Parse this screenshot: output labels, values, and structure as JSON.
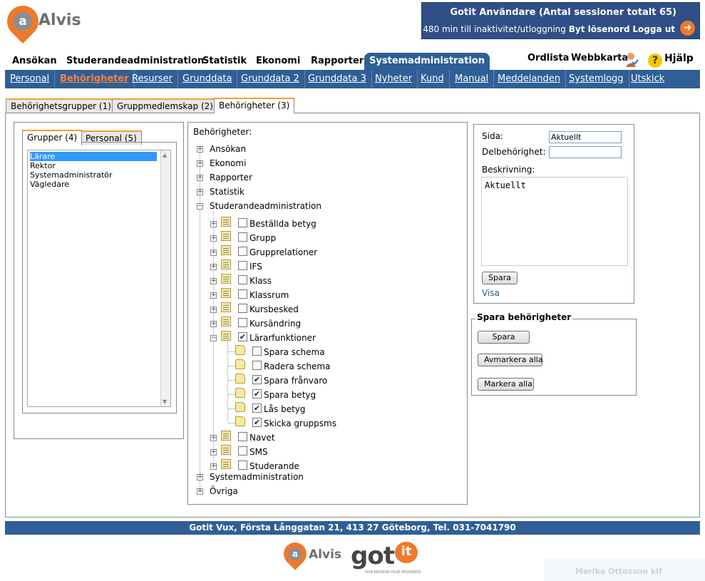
{
  "header": {
    "brand": "Alvis",
    "brand_letter": "a",
    "user_line": "Gotit Användare (Antal sessioner totalt 65)",
    "session_text": "480 min till inaktivitet/utloggning",
    "change_password": "Byt lösenord",
    "logout": "Logga ut",
    "logout_icon": "arrow-right-circle-icon"
  },
  "main_menu": [
    {
      "label": "Ansökan",
      "active": false
    },
    {
      "label": "Studerandeadministration",
      "active": false
    },
    {
      "label": "Statistik",
      "active": false
    },
    {
      "label": "Ekonomi",
      "active": false
    },
    {
      "label": "Rapporter",
      "active": false
    },
    {
      "label": "Systemadministration",
      "active": true
    }
  ],
  "top_links": {
    "glossary": "Ordlista",
    "sitemap": "Webbkarta",
    "help": "Hjälp",
    "help_icon": "?"
  },
  "sub_menu": [
    {
      "label": "Personal",
      "active": false
    },
    {
      "label": "Behörigheter",
      "active": true
    },
    {
      "label": "Resurser",
      "active": false
    },
    {
      "label": "Grunddata",
      "active": false
    },
    {
      "label": "Grunddata 2",
      "active": false
    },
    {
      "label": "Grunddata 3",
      "active": false
    },
    {
      "label": "Nyheter",
      "active": false
    },
    {
      "label": "Kund",
      "active": false
    },
    {
      "label": "Manual",
      "active": false
    },
    {
      "label": "Meddelanden",
      "active": false
    },
    {
      "label": "Systemlogg",
      "active": false
    },
    {
      "label": "Utskick",
      "active": false
    }
  ],
  "outer_tabs": [
    {
      "label": "Behörighetsgrupper (1)",
      "active": false
    },
    {
      "label": "Gruppmedlemskap (2)",
      "active": false
    },
    {
      "label": "Behörigheter (3)",
      "active": true
    }
  ],
  "group_tabs": [
    {
      "label": "Grupper (4)",
      "active": true
    },
    {
      "label": "Personal (5)",
      "active": false
    }
  ],
  "groups": [
    {
      "label": "Lärare",
      "selected": true
    },
    {
      "label": "Rektor",
      "selected": false
    },
    {
      "label": "Systemadministratör",
      "selected": false
    },
    {
      "label": "Vägledare",
      "selected": false
    }
  ],
  "tree": {
    "heading": "Behörigheter:",
    "top_before": [
      "Ansökan",
      "Ekonomi",
      "Rapporter",
      "Statistik"
    ],
    "expanded": "Studerandeadministration",
    "children": [
      {
        "label": "Beställda betyg",
        "checked": false,
        "expanded": false
      },
      {
        "label": "Grupp",
        "checked": false,
        "expanded": false
      },
      {
        "label": "Grupprelationer",
        "checked": false,
        "expanded": false
      },
      {
        "label": "IFS",
        "checked": false,
        "expanded": false
      },
      {
        "label": "Klass",
        "checked": false,
        "expanded": false
      },
      {
        "label": "Klassrum",
        "checked": false,
        "expanded": false
      },
      {
        "label": "Kursbesked",
        "checked": false,
        "expanded": false
      },
      {
        "label": "Kursändring",
        "checked": false,
        "expanded": false
      },
      {
        "label": "Lärarfunktioner",
        "checked": true,
        "expanded": true
      }
    ],
    "leaves": [
      {
        "label": "Spara schema",
        "checked": false
      },
      {
        "label": "Radera schema",
        "checked": false
      },
      {
        "label": "Spara frånvaro",
        "checked": true
      },
      {
        "label": "Spara betyg",
        "checked": true
      },
      {
        "label": "Lås betyg",
        "checked": true
      },
      {
        "label": "Skicka gruppsms",
        "checked": true
      }
    ],
    "children_after": [
      {
        "label": "Navet",
        "checked": false
      },
      {
        "label": "SMS",
        "checked": false
      },
      {
        "label": "Studerande",
        "checked": false
      }
    ],
    "top_after": [
      "Systemadministration",
      "Övriga"
    ]
  },
  "form": {
    "page_label": "Sida:",
    "page_value": "Aktuellt",
    "sub_label": "Delbehörighet:",
    "sub_value": "",
    "desc_label": "Beskrivning:",
    "desc_value": "Aktuellt",
    "save": "Spara",
    "show": "Visa"
  },
  "save_permissions": {
    "legend": "Spara behörigheter",
    "save": "Spara",
    "unmark_all": "Avmarkera alla",
    "mark_all": "Markera alla"
  },
  "footer": {
    "address": "Gotit Vux, Första Långgatan 21, 413 27 Göteborg, Tel. 031-7041790",
    "alvis": "Alvis",
    "got": "got",
    "it": "it",
    "tagline": "OUR MISSION YOUR PROGRESS"
  },
  "ghost_notification": {
    "name": "Marika Ottosson  klf"
  },
  "colors": {
    "brand_orange": "#f0782a",
    "nav_blue": "#2f5f96",
    "header_blue": "#2f4f86",
    "selection_blue": "#3399ff"
  }
}
